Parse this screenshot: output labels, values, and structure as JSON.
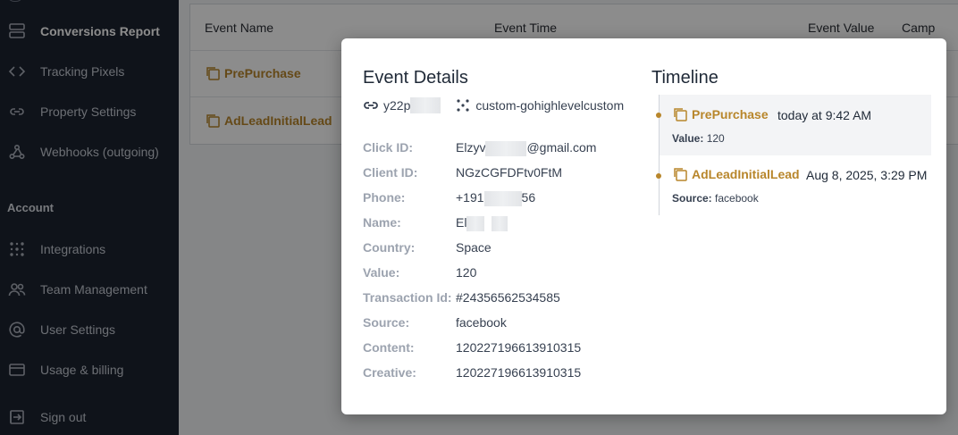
{
  "sidebar": {
    "items": [
      {
        "label": "Conversions Report",
        "icon": "server-stack-icon"
      },
      {
        "label": "Tracking Pixels",
        "icon": "code-icon"
      },
      {
        "label": "Property Settings",
        "icon": "link-icon"
      },
      {
        "label": "Webhooks (outgoing)",
        "icon": "webhook-icon"
      }
    ],
    "account_section": "Account",
    "account_items": [
      {
        "label": "Integrations",
        "icon": "integrations-icon"
      },
      {
        "label": "Team Management",
        "icon": "team-icon"
      },
      {
        "label": "User Settings",
        "icon": "at-sign-icon"
      },
      {
        "label": "Usage & billing",
        "icon": "credit-card-icon"
      },
      {
        "label": "Sign out",
        "icon": "sign-out-icon"
      }
    ]
  },
  "table": {
    "headers": [
      "Event Name",
      "Event Time",
      "Event Value",
      "Camp"
    ],
    "rows": [
      {
        "event_name": "PrePurchase"
      },
      {
        "event_name": "AdLeadInitialLead"
      }
    ]
  },
  "modal": {
    "details_title": "Event Details",
    "timeline_title": "Timeline",
    "pixel_id_visible": "y22p",
    "property_name": "custom-gohighlevelcustom",
    "fields": {
      "click_id_label": "Click ID:",
      "click_id_value_start": "Elzyv",
      "click_id_value_end": "@gmail.com",
      "client_id_label": "Client ID:",
      "client_id_value": "NGzCGFDFtv0FtM",
      "phone_label": "Phone:",
      "phone_value_start": "+191",
      "phone_value_end": "56",
      "name_label": "Name:",
      "name_value_start": "El",
      "country_label": "Country:",
      "country_value": "Space",
      "value_label": "Value:",
      "value_value": "120",
      "transaction_label": "Transaction Id:",
      "transaction_value": "#24356562534585",
      "source_label": "Source:",
      "source_value": "facebook",
      "content_label": "Content:",
      "content_value": "120227196613910315",
      "creative_label": "Creative:",
      "creative_value": "120227196613910315"
    },
    "timeline": [
      {
        "event": "PrePurchase",
        "time": "today at 9:42 AM",
        "sub_label": "Value:",
        "sub_value": "120"
      },
      {
        "event": "AdLeadInitialLead",
        "time": "Aug 8, 2025, 3:29 PM",
        "sub_label": "Source:",
        "sub_value": "facebook"
      }
    ]
  },
  "colors": {
    "accent": "#b8862b",
    "sidebar_bg": "#1c2330"
  }
}
